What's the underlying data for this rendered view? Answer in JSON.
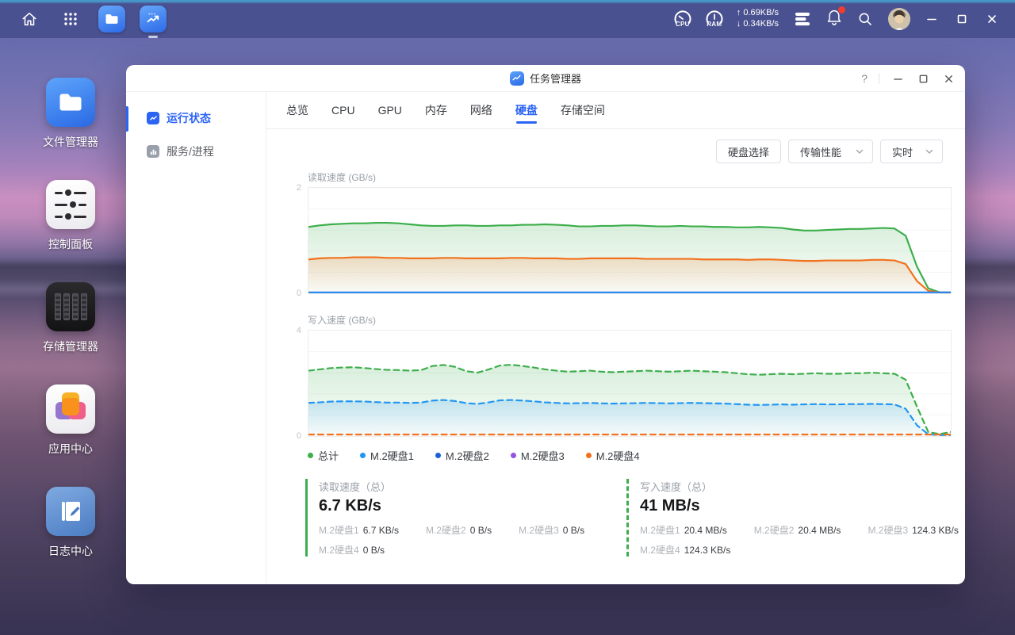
{
  "taskbar": {
    "cpu_label": "CPU",
    "ram_label": "RAM",
    "net_up": "↑ 0.69KB/s",
    "net_down": "↓ 0.34KB/s"
  },
  "desktop_icons": [
    {
      "label": "文件管理器"
    },
    {
      "label": "控制面板"
    },
    {
      "label": "存储管理器"
    },
    {
      "label": "应用中心"
    },
    {
      "label": "日志中心"
    }
  ],
  "window": {
    "title": "任务管理器",
    "help_label": "?",
    "sidebar": [
      {
        "label": "运行状态"
      },
      {
        "label": "服务/进程"
      }
    ],
    "tabs": [
      {
        "label": "总览"
      },
      {
        "label": "CPU"
      },
      {
        "label": "GPU"
      },
      {
        "label": "内存"
      },
      {
        "label": "网络"
      },
      {
        "label": "硬盘"
      },
      {
        "label": "存储空间"
      }
    ],
    "active_tab": "硬盘",
    "controls": {
      "disk_select": "硬盘选择",
      "perf": "传输性能",
      "interval": "实时"
    },
    "legend": [
      {
        "label": "总计",
        "color": "#3cae4c"
      },
      {
        "label": "M.2硬盘1",
        "color": "#2196f3"
      },
      {
        "label": "M.2硬盘2",
        "color": "#1b5fd9"
      },
      {
        "label": "M.2硬盘3",
        "color": "#9254de"
      },
      {
        "label": "M.2硬盘4",
        "color": "#f2711c"
      }
    ],
    "stats": {
      "read": {
        "title": "读取速度（总）",
        "value": "6.7 KB/s",
        "rows": [
          {
            "label": "M.2硬盘1",
            "value": "6.7 KB/s"
          },
          {
            "label": "M.2硬盘2",
            "value": "0 B/s"
          },
          {
            "label": "M.2硬盘3",
            "value": "0 B/s"
          },
          {
            "label": "M.2硬盘4",
            "value": "0 B/s"
          }
        ]
      },
      "write": {
        "title": "写入速度（总）",
        "value": "41 MB/s",
        "rows": [
          {
            "label": "M.2硬盘1",
            "value": "20.4 MB/s"
          },
          {
            "label": "M.2硬盘2",
            "value": "20.4 MB/s"
          },
          {
            "label": "M.2硬盘3",
            "value": "124.3 KB/s"
          },
          {
            "label": "M.2硬盘4",
            "value": "124.3 KB/s"
          }
        ]
      }
    }
  },
  "chart_data": [
    {
      "type": "area",
      "title": "读取速度 (GB/s)",
      "ylabel": "GB/s",
      "ylim": [
        0,
        2
      ],
      "dashed": false,
      "grid": true,
      "legend_position": "bottom",
      "series": [
        {
          "name": "总计",
          "color": "#3cae4c",
          "fill": true,
          "values": [
            1.27,
            1.3,
            1.32,
            1.33,
            1.34,
            1.34,
            1.35,
            1.35,
            1.34,
            1.32,
            1.3,
            1.29,
            1.29,
            1.3,
            1.3,
            1.29,
            1.29,
            1.3,
            1.3,
            1.31,
            1.31,
            1.32,
            1.31,
            1.3,
            1.28,
            1.28,
            1.29,
            1.29,
            1.3,
            1.3,
            1.29,
            1.28,
            1.28,
            1.29,
            1.28,
            1.28,
            1.27,
            1.27,
            1.26,
            1.26,
            1.27,
            1.26,
            1.25,
            1.22,
            1.2,
            1.2,
            1.21,
            1.22,
            1.23,
            1.23,
            1.24,
            1.25,
            1.24,
            1.1,
            0.5,
            0.08,
            0.0,
            0.0
          ]
        },
        {
          "name": "M.2硬盘4",
          "color": "#f2711c",
          "fill": true,
          "values": [
            0.64,
            0.66,
            0.67,
            0.67,
            0.68,
            0.68,
            0.68,
            0.67,
            0.67,
            0.66,
            0.66,
            0.66,
            0.67,
            0.67,
            0.66,
            0.66,
            0.66,
            0.66,
            0.67,
            0.67,
            0.66,
            0.66,
            0.66,
            0.65,
            0.65,
            0.66,
            0.66,
            0.66,
            0.66,
            0.66,
            0.65,
            0.65,
            0.65,
            0.65,
            0.65,
            0.64,
            0.64,
            0.64,
            0.64,
            0.63,
            0.64,
            0.64,
            0.63,
            0.62,
            0.61,
            0.61,
            0.62,
            0.62,
            0.62,
            0.62,
            0.63,
            0.63,
            0.62,
            0.55,
            0.22,
            0.03,
            0.0,
            0.0
          ]
        },
        {
          "name": "M.2硬盘1",
          "color": "#2186f0",
          "fill": false,
          "values": [
            0,
            0
          ]
        }
      ]
    },
    {
      "type": "area",
      "title": "写入速度 (GB/s)",
      "ylabel": "GB/s",
      "ylim": [
        0,
        4
      ],
      "dashed": true,
      "grid": true,
      "legend_position": "bottom",
      "series": [
        {
          "name": "总计",
          "color": "#3cae4c",
          "fill": true,
          "values": [
            2.5,
            2.55,
            2.6,
            2.62,
            2.63,
            2.6,
            2.56,
            2.53,
            2.52,
            2.5,
            2.52,
            2.68,
            2.72,
            2.65,
            2.48,
            2.42,
            2.55,
            2.7,
            2.73,
            2.68,
            2.62,
            2.55,
            2.5,
            2.46,
            2.48,
            2.5,
            2.46,
            2.44,
            2.46,
            2.48,
            2.5,
            2.48,
            2.46,
            2.48,
            2.5,
            2.48,
            2.46,
            2.44,
            2.4,
            2.36,
            2.34,
            2.36,
            2.38,
            2.36,
            2.38,
            2.4,
            2.38,
            2.38,
            2.4,
            2.4,
            2.42,
            2.4,
            2.38,
            2.15,
            1.1,
            0.12,
            0.04,
            0.12
          ]
        },
        {
          "name": "M.2硬盘1",
          "color": "#2196f3",
          "fill": true,
          "values": [
            1.25,
            1.27,
            1.3,
            1.31,
            1.31,
            1.3,
            1.28,
            1.26,
            1.26,
            1.25,
            1.26,
            1.34,
            1.36,
            1.32,
            1.24,
            1.21,
            1.27,
            1.35,
            1.36,
            1.34,
            1.31,
            1.27,
            1.25,
            1.23,
            1.24,
            1.25,
            1.23,
            1.22,
            1.23,
            1.24,
            1.25,
            1.24,
            1.23,
            1.24,
            1.25,
            1.24,
            1.23,
            1.22,
            1.2,
            1.18,
            1.17,
            1.18,
            1.19,
            1.18,
            1.19,
            1.2,
            1.19,
            1.19,
            1.2,
            1.2,
            1.21,
            1.2,
            1.19,
            1.02,
            0.38,
            0.03,
            0.0,
            0.0
          ]
        },
        {
          "name": "M.2硬盘4",
          "color": "#f2711c",
          "fill": false,
          "values": [
            0.02,
            0.02
          ]
        }
      ]
    }
  ]
}
